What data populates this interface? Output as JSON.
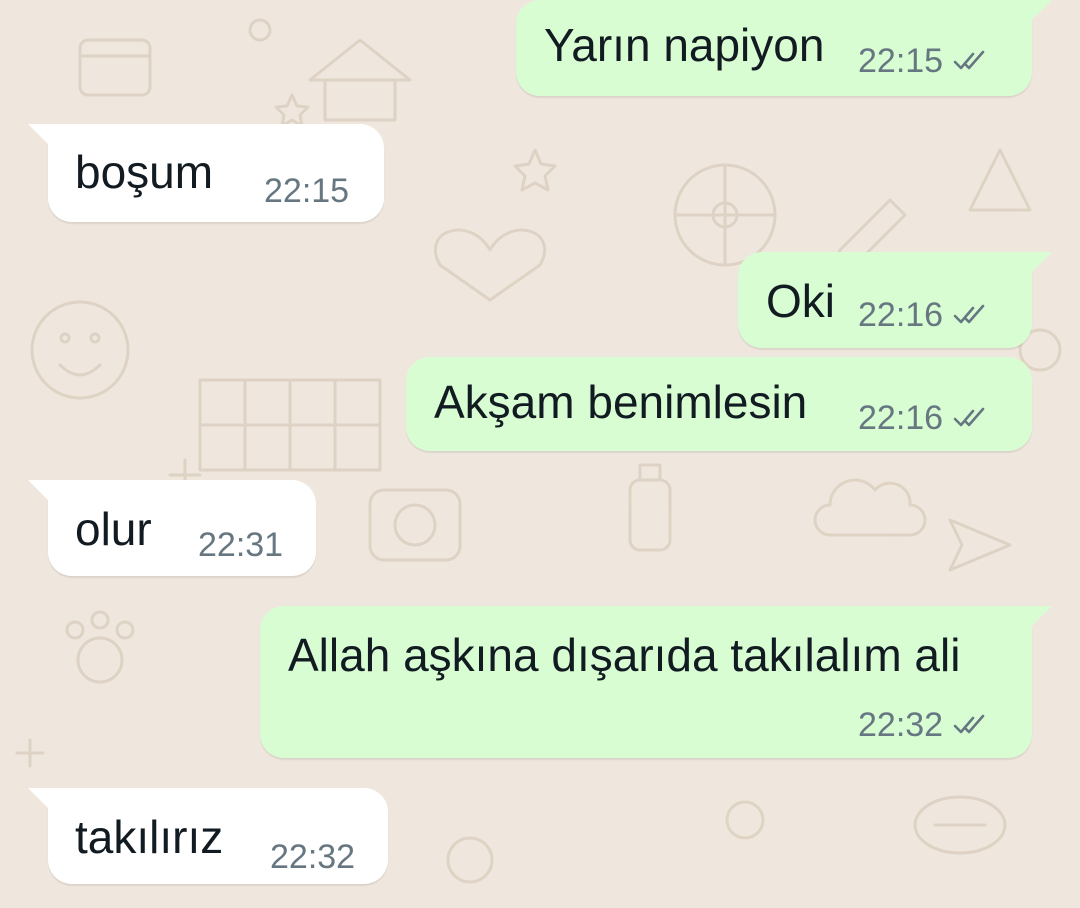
{
  "chat": {
    "wallpaper_color": "#efe7dd",
    "outgoing_bubble_color": "#d9fdd3",
    "incoming_bubble_color": "#ffffff",
    "messages": [
      {
        "direction": "out",
        "text": "Yarın napiyon",
        "time": "22:15",
        "status": "read"
      },
      {
        "direction": "in",
        "text": "boşum",
        "time": "22:15"
      },
      {
        "direction": "out",
        "text": "Oki",
        "time": "22:16",
        "status": "read"
      },
      {
        "direction": "out",
        "text": "Akşam benimlesin",
        "time": "22:16",
        "status": "read"
      },
      {
        "direction": "in",
        "text": "olur",
        "time": "22:31"
      },
      {
        "direction": "out",
        "text": "Allah aşkına dışarıda takılalım ali",
        "time": "22:32",
        "status": "read"
      },
      {
        "direction": "in",
        "text": "takılırız",
        "time": "22:32"
      }
    ]
  }
}
